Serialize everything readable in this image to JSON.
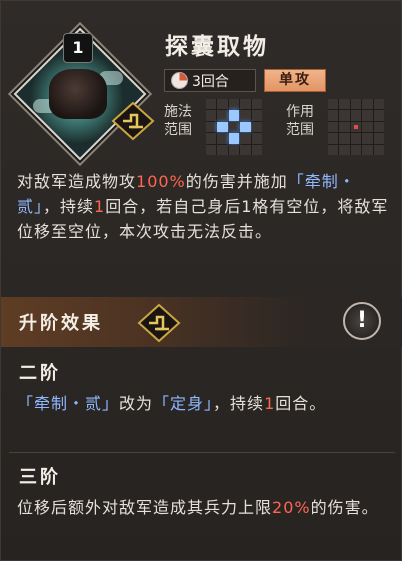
{
  "skill": {
    "level": "1",
    "title": "探囊取物",
    "rounds": "3回合",
    "attack_type": "单攻",
    "cast_range_label_1": "施法",
    "cast_range_label_2": "范围",
    "effect_range_label_1": "作用",
    "effect_range_label_2": "范围"
  },
  "description": {
    "p1": "对敌军造成物攻",
    "pct": "100%",
    "p2": "的伤害并施加",
    "status": "「牵制・贰」",
    "p3": "，持续",
    "dur": "1",
    "p4": "回合，若自己身后1格有空位，将敌军位移至空位，本次攻击无法反击。"
  },
  "upgrade": {
    "title": "升阶效果",
    "tier2_title": "二阶",
    "tier2_status_from": "「牵制・贰」",
    "tier2_mid": "改为",
    "tier2_status_to": "「定身」",
    "tier2_tail": "，持续",
    "tier2_dur": "1",
    "tier2_end": "回合。",
    "tier3_title": "三阶",
    "tier3_text": "位移后额外对敌军造成其兵力上限",
    "tier3_pct": "20%",
    "tier3_end": "的伤害。"
  },
  "colors": {
    "accent_red": "#ff6650",
    "accent_blue": "#8fb8ff",
    "attack_tag": "#e29564"
  }
}
